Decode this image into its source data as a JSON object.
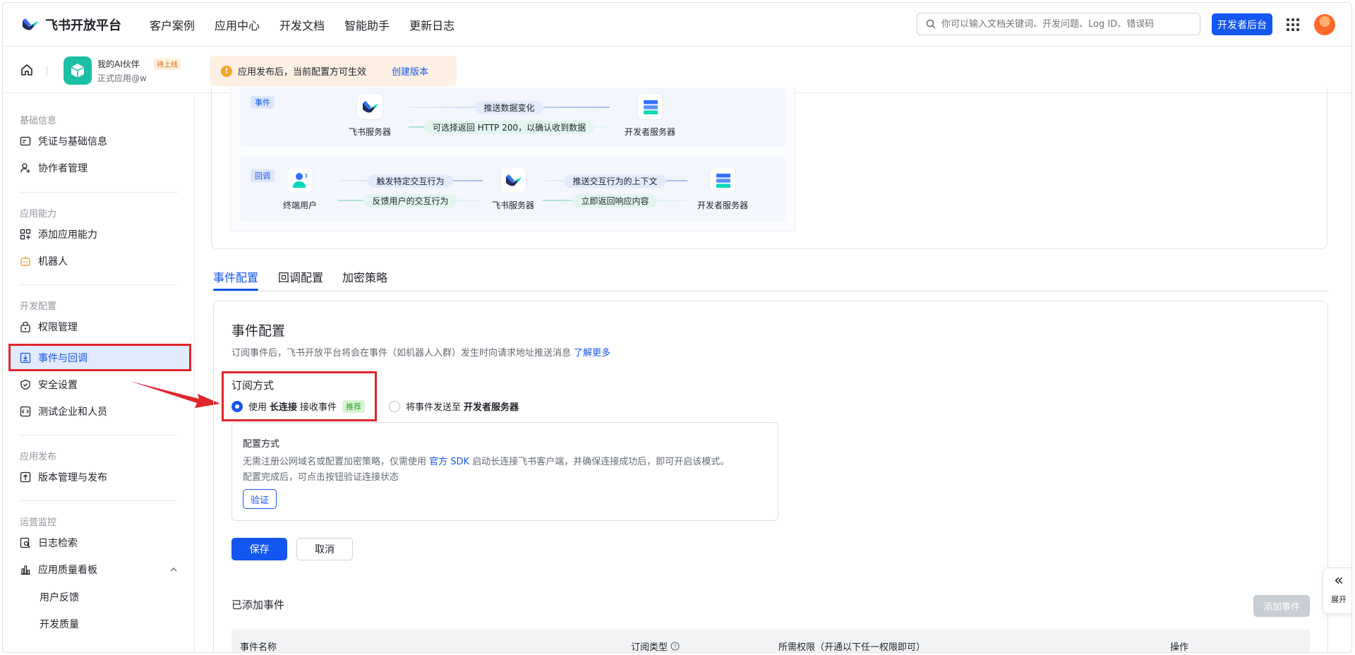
{
  "topnav": {
    "logo_text": "飞书开放平台",
    "links": [
      "客户案例",
      "应用中心",
      "开发文档",
      "智能助手",
      "更新日志"
    ],
    "search_placeholder": "你可以输入文档关键词、开发问题、Log ID、错误码",
    "dev_console_label": "开发者后台"
  },
  "subhead": {
    "app_name": "我的AI伙伴",
    "app_tag": "待上线",
    "app_sub": "正式应用@w",
    "notice_text": "应用发布后，当前配置方可生效",
    "notice_link": "创建版本"
  },
  "sidebar": {
    "groups": {
      "basic": "基础信息",
      "ability": "应用能力",
      "dev": "开发配置",
      "release": "应用发布",
      "ops": "运营监控"
    },
    "items": {
      "credentials": "凭证与基础信息",
      "collaborators": "协作者管理",
      "add_ability": "添加应用能力",
      "bot": "机器人",
      "permissions": "权限管理",
      "events": "事件与回调",
      "security": "安全设置",
      "test_org": "测试企业和人员",
      "versions": "版本管理与发布",
      "log_search": "日志检索",
      "quality_board": "应用质量看板",
      "feedback": "用户反馈",
      "dev_quality": "开发质量"
    }
  },
  "diagram": {
    "event_tag": "事件",
    "callback_tag": "回调",
    "feishu_server": "飞书服务器",
    "dev_server": "开发者服务器",
    "end_user": "终端用户",
    "push_data_change": "推送数据变化",
    "return_http_200": "可选择返回 HTTP 200，以确认收到数据",
    "trigger_interaction": "触发特定交互行为",
    "feedback_interaction": "反馈用户的交互行为",
    "push_context": "推送交互行为的上下文",
    "return_response": "立即返回响应内容"
  },
  "tabs": [
    "事件配置",
    "回调配置",
    "加密策略"
  ],
  "config": {
    "title": "事件配置",
    "desc": "订阅事件后，飞书开放平台将会在事件（如机器人入群）发生时向请求地址推送消息",
    "desc_link": "了解更多",
    "mode_title": "订阅方式",
    "option1_prefix": "使用",
    "option1_bold": "长连接",
    "option1_suffix": "接收事件",
    "option1_tag": "推荐",
    "option2_prefix": "将事件发送至",
    "option2_bold": "开发者服务器",
    "method_title": "配置方式",
    "method_desc_1": "无需注册公网域名或配置加密策略，仅需使用",
    "method_desc_link": "官方 SDK",
    "method_desc_2": "启动长连接飞书客户端，并确保连接成功后，即可开启该模式。",
    "method_desc_3": "配置完成后，可点击按钮验证连接状态",
    "verify": "验证",
    "save": "保存",
    "cancel": "取消"
  },
  "events": {
    "title": "已添加事件",
    "add_button": "添加事件",
    "columns": [
      "事件名称",
      "订阅类型",
      "所需权限（开通以下任一权限即可）",
      "操作"
    ]
  },
  "expand_label": "展开"
}
